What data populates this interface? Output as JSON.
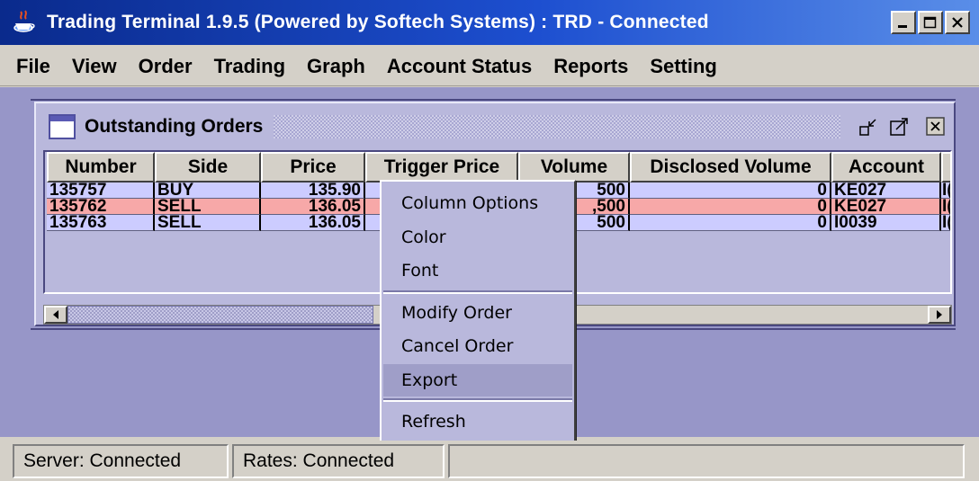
{
  "window": {
    "title": "Trading Terminal 1.9.5 (Powered by Softech Systems)  :  TRD - Connected",
    "icon": "java-cup-icon",
    "buttons": [
      "minimize",
      "maximize",
      "close"
    ]
  },
  "menubar": {
    "items": [
      {
        "label": "File"
      },
      {
        "label": "View"
      },
      {
        "label": "Order"
      },
      {
        "label": "Trading"
      },
      {
        "label": "Graph"
      },
      {
        "label": "Account Status"
      },
      {
        "label": "Reports"
      },
      {
        "label": "Setting"
      }
    ]
  },
  "orders_window": {
    "title": "Outstanding Orders",
    "controls": [
      "restore-icon",
      "maximize-icon",
      "close-icon"
    ],
    "columns": [
      "Number",
      "Side",
      "Price",
      "Trigger Price",
      "Volume",
      "Disclosed Volume",
      "Account"
    ],
    "rows": [
      {
        "number": "135757",
        "side": "BUY",
        "price": "135.90",
        "trigger": "",
        "volume": "500",
        "disclosed": "0",
        "account": "KE027",
        "extra": "I("
      },
      {
        "number": "135762",
        "side": "SELL",
        "price": "136.05",
        "trigger": "",
        "volume": ",500",
        "disclosed": "0",
        "account": "KE027",
        "extra": "I("
      },
      {
        "number": "135763",
        "side": "SELL",
        "price": "136.05",
        "trigger": "",
        "volume": "500",
        "disclosed": "0",
        "account": "I0039",
        "extra": "I("
      }
    ]
  },
  "context_menu": {
    "items": [
      "Column Options",
      "Color",
      "Font",
      "Modify Order",
      "Cancel Order",
      "Export",
      "Refresh"
    ],
    "highlighted": "Export"
  },
  "statusbar": {
    "server": "Server: Connected",
    "rates": "Rates: Connected"
  },
  "colors": {
    "title_gradient_start": "#0a2a8c",
    "desktop": "#9796c8",
    "buy_row": "#ccccff",
    "sell_selected_row": "#f7a8a8",
    "menu_highlight": "#9f9ec8"
  }
}
